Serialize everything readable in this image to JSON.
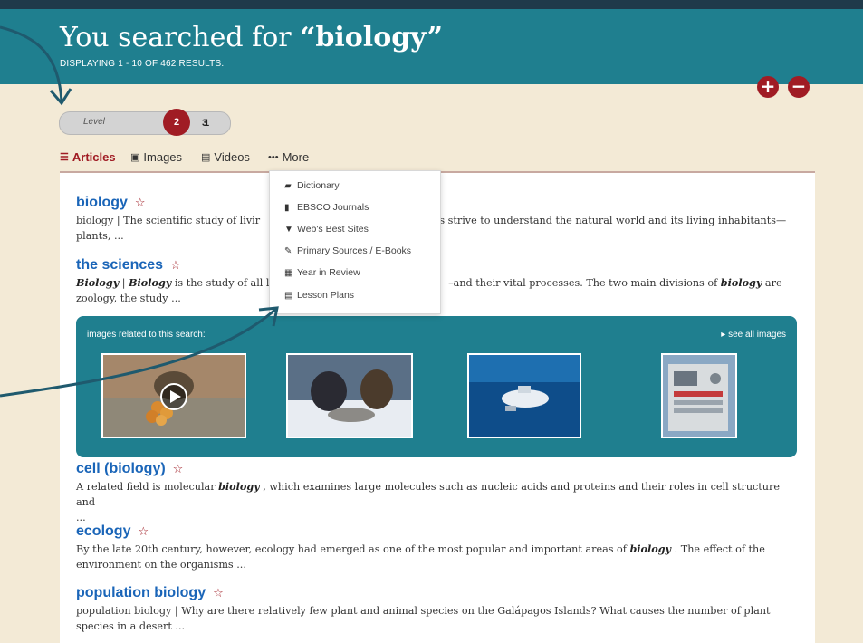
{
  "header": {
    "title_prefix": "You searched for ",
    "query": "“biology”",
    "subtitle": "DISPLAYING 1 - 10 OF 462 RESULTS.",
    "background": "#1f7f8f"
  },
  "zoom": {
    "plus_label": "+",
    "minus_label": "−"
  },
  "level": {
    "label": "Level",
    "options": [
      "1",
      "2",
      "3"
    ],
    "selected": "2",
    "accent": "#a01c24"
  },
  "tabs": [
    {
      "label": "Articles",
      "icon": "list-icon",
      "active": true
    },
    {
      "label": "Images",
      "icon": "image-icon",
      "active": false
    },
    {
      "label": "Videos",
      "icon": "film-icon",
      "active": false
    },
    {
      "label": "More",
      "icon": "ellipsis-icon",
      "active": false
    }
  ],
  "more_menu": [
    {
      "label": "Dictionary",
      "icon": "book-icon"
    },
    {
      "label": "EBSCO Journals",
      "icon": "document-icon"
    },
    {
      "label": "Web's Best Sites",
      "icon": "bookmark-icon"
    },
    {
      "label": "Primary Sources / E-Books",
      "icon": "edit-icon"
    },
    {
      "label": "Year in Review",
      "icon": "calendar-icon"
    },
    {
      "label": "Lesson Plans",
      "icon": "list-box-icon"
    }
  ],
  "results": [
    {
      "title": "biology",
      "snippet": "biology | The scientific study of livir",
      "snippet_tail": "sts strive to understand the natural world and its living inhabitants—",
      "snippet_line2": "plants, ..."
    },
    {
      "title": "the sciences",
      "snippet_b1": "Biology",
      "snippet_sep": " | ",
      "snippet_b2": "Biology",
      "snippet": " is the study of all li",
      "snippet_tail": "–and their vital processes. The two main divisions of ",
      "snippet_b3": "biology",
      "snippet_tail2": " are",
      "snippet_line2": "zoology, the study ..."
    },
    {
      "title": "cell (biology)",
      "snippet": "A related field is molecular ",
      "snippet_b": "biology",
      "snippet_tail": " , which examines large molecules such as nucleic acids and proteins and their roles in cell structure and",
      "snippet_line2": "..."
    },
    {
      "title": "ecology",
      "snippet": "By the late 20th century, however, ecology had emerged as one of the most popular and important areas of ",
      "snippet_b": "biology",
      "snippet_tail": " . The effect of the",
      "snippet_line2": "environment on the organisms ..."
    },
    {
      "title": "population biology",
      "snippet": "population biology  |  Why are there relatively few plant and animal species on the Galápagos Islands? What causes the number of plant",
      "snippet_line2": "species in a desert ..."
    }
  ],
  "images_panel": {
    "label": "images related to this search:",
    "see_all": "▸ see all images"
  },
  "colors": {
    "accent": "#a01c24",
    "link": "#1a65b8",
    "teal": "#1f7f8f",
    "page": "#f3ead6",
    "annotation": "#1f5a6e"
  }
}
